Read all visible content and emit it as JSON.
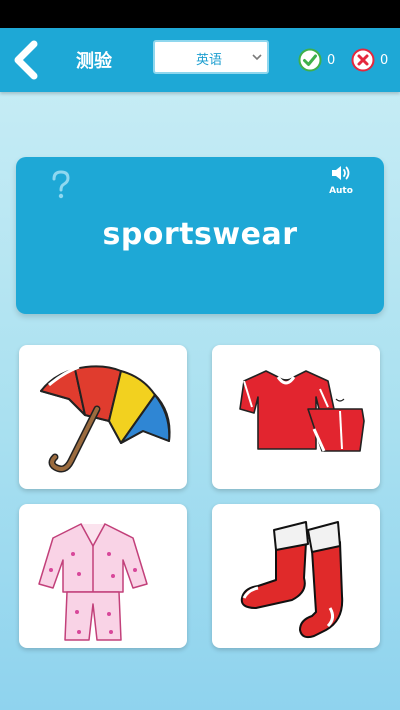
{
  "header": {
    "title": "测验",
    "language_selected": "英语",
    "correct_count": "0",
    "wrong_count": "0"
  },
  "card": {
    "word": "sportswear",
    "auto_label": "Auto"
  },
  "options": [
    {
      "icon": "umbrella"
    },
    {
      "icon": "sports-uniform"
    },
    {
      "icon": "pajamas"
    },
    {
      "icon": "socks"
    }
  ],
  "colors": {
    "header_bg": "#1ea8d6",
    "card_bg": "#1ea8d6",
    "correct": "#3fb04a",
    "wrong": "#e5283d",
    "accent_text": "#1e9fd0"
  }
}
